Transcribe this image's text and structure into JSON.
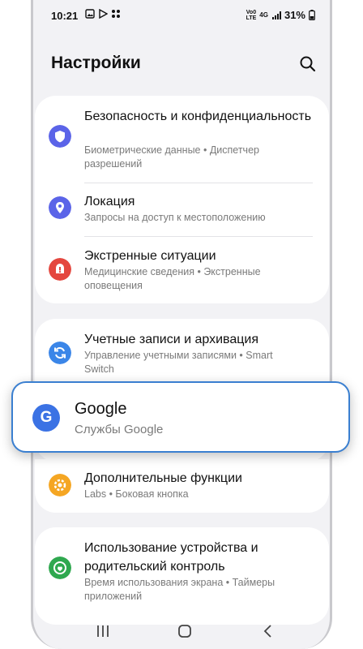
{
  "status": {
    "time": "10:21",
    "network_top": "Vo0",
    "network_bottom": "LTE",
    "network_type": "4G",
    "battery": "31%"
  },
  "header": {
    "title": "Настройки"
  },
  "groups": [
    {
      "items": [
        {
          "title": "Безопасность и конфиденциальность",
          "subtitle": "Биометрические данные • Диспетчер разрешений",
          "icon": "shield-icon",
          "color": "#5b64e8"
        },
        {
          "title": "Локация",
          "subtitle": "Запросы на доступ к местоположению",
          "icon": "location-pin-icon",
          "color": "#5b64e8"
        },
        {
          "title": "Экстренные ситуации",
          "subtitle": "Медицинские сведения • Экстренные оповещения",
          "icon": "emergency-icon",
          "color": "#e4473f"
        }
      ]
    },
    {
      "items": [
        {
          "title": "Учетные записи и архивация",
          "subtitle": "Управление учетными записями • Smart Switch",
          "icon": "sync-icon",
          "color": "#3b86e8"
        }
      ]
    },
    {
      "items": [
        {
          "title": "Дополнительные функции",
          "subtitle": "Labs • Боковая кнопка",
          "icon": "plus-gear-icon",
          "color": "#f5a623"
        }
      ]
    },
    {
      "items": [
        {
          "title": "Использование устройства и родительский контроль",
          "subtitle": "Время использования экрана • Таймеры приложений",
          "icon": "wellbeing-icon",
          "color": "#2fa84f"
        }
      ]
    }
  ],
  "highlight": {
    "title": "Google",
    "subtitle": "Службы Google",
    "icon_letter": "G",
    "icon": "google-icon",
    "color": "#3b72e4",
    "border_color": "#3a7fd0"
  },
  "navbar": {
    "buttons": [
      "recent-apps",
      "home",
      "back"
    ]
  }
}
